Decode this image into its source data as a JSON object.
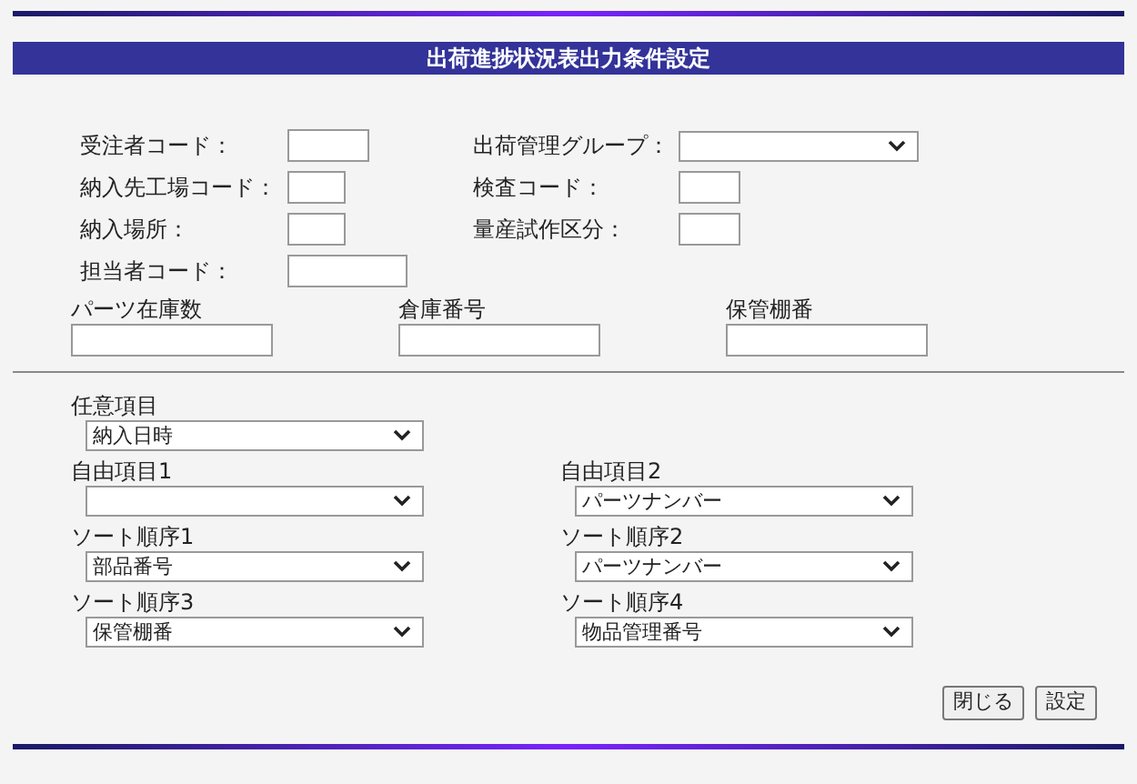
{
  "title": "出荷進捗状況表出力条件設定",
  "conditions": [
    {
      "left": {
        "label": "受注者コード：",
        "kind": "input"
      },
      "right": {
        "label": "出荷管理グループ：",
        "kind": "select"
      }
    },
    {
      "left": {
        "label": "納入先工場コード：",
        "kind": "input"
      },
      "right": {
        "label": "検査コード：",
        "kind": "input"
      }
    },
    {
      "left": {
        "label": "納入場所：",
        "kind": "input"
      },
      "right": {
        "label": "量産試作区分：",
        "kind": "input"
      }
    },
    {
      "left": {
        "label": "担当者コード：",
        "kind": "input"
      }
    }
  ],
  "stock_fields": [
    {
      "label": "パーツ在庫数"
    },
    {
      "label": "倉庫番号"
    },
    {
      "label": "保管棚番"
    }
  ],
  "optional_item": {
    "label": "任意項目",
    "value": "納入日時"
  },
  "select_rows": [
    {
      "left": {
        "label": "自由項目1"
      },
      "right": {
        "label": "自由項目2",
        "value": "パーツナンバー"
      }
    },
    {
      "left": {
        "label": "ソート順序1",
        "value": "部品番号"
      },
      "right": {
        "label": "ソート順序2",
        "value": "パーツナンバー"
      }
    },
    {
      "left": {
        "label": "ソート順序3",
        "value": "保管棚番"
      },
      "right": {
        "label": "ソート順序4",
        "value": "物品管理番号"
      }
    }
  ],
  "buttons": [
    "閉じる",
    "設定"
  ]
}
